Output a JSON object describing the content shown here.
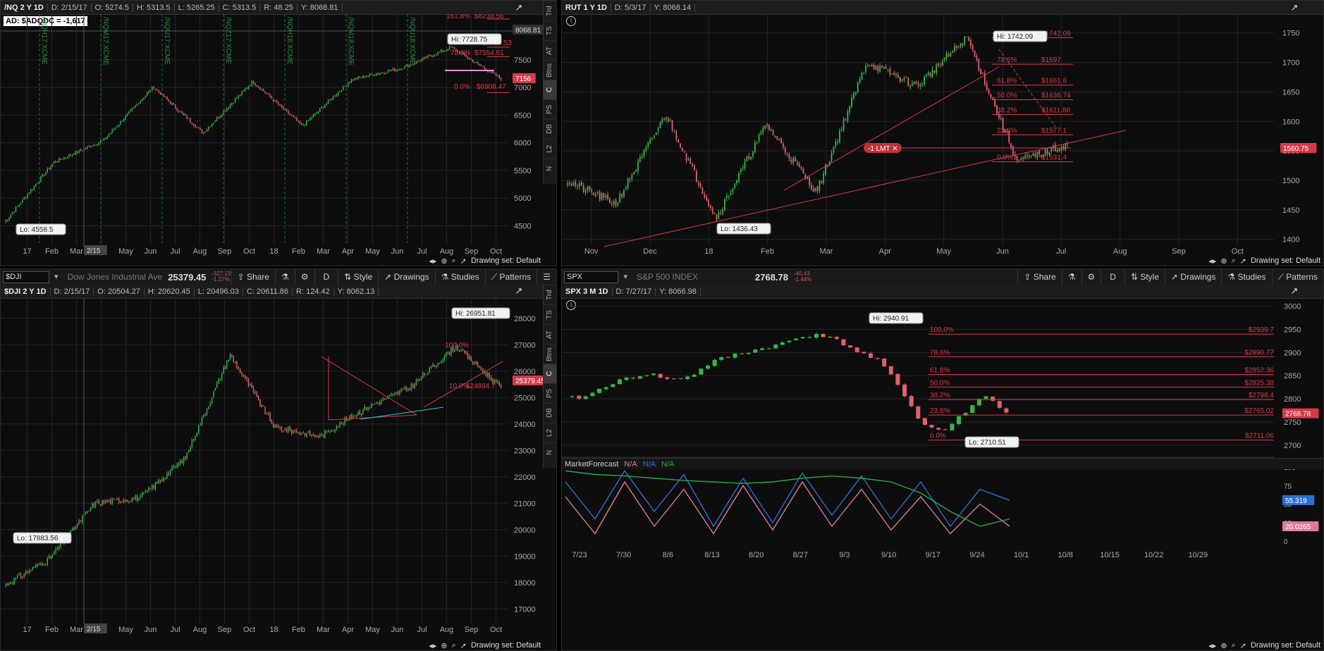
{
  "colors": {
    "up": "#2fb84a",
    "down": "#e0606b",
    "fib": "#d8384a",
    "grid": "#242424",
    "axis": "#aaaaaa",
    "bg": "#0d0d0d"
  },
  "drawing_set": "Drawing set: Default",
  "side_tabs": [
    "Trd",
    "TS",
    "AT",
    "Btns",
    "C",
    "PS",
    "DB",
    "L2",
    "N"
  ],
  "top_left": {
    "header": {
      "symbol": "/NQ 2 Y 1D",
      "d": "D: 2/15/17",
      "o": "O: 5274.5",
      "h": "H: 5313.5",
      "l": "L: 5265.25",
      "c": "C: 5313.5",
      "r": "R: 48.25",
      "y": "Y: 8068.81"
    },
    "ad_label": "AD: $ADQDC = -1,617",
    "price_tags": {
      "top": "8068.81",
      "last": "7156"
    },
    "hi_label": "Hi: 7728.75",
    "lo_label": "Lo: 4558.5",
    "cursor_date": "2/15",
    "contract_labels": [
      "/NQH17:XCME",
      "/NQM17:XCME",
      "/NQU17:XCME",
      "/NQZ17:XCME",
      "/NQH18:XCME",
      "/NQM18:XCME",
      "/NQU18:XCME"
    ],
    "fib_labels": [
      "161.8%",
      "$8238.56",
      "78.6%",
      "$7554.61",
      "0.0%",
      "$6908.47",
      "$7780.53"
    ],
    "chart_data": {
      "type": "line",
      "title": "/NQ 2 Y 1D",
      "x": [
        "2/15/17",
        "6/1/17",
        "10/1/17",
        "1/26/18",
        "2/9/18",
        "3/12/18",
        "4/2/18",
        "6/1/18",
        "8/1/18",
        "8/30/18",
        "10/11/18"
      ],
      "values": [
        4558.5,
        5650,
        6050,
        7010,
        6180,
        7110,
        6300,
        7150,
        7350,
        7728.75,
        7156
      ],
      "x_ticks": [
        "17",
        "Feb",
        "Mar",
        "Apr",
        "May",
        "Jun",
        "Jul",
        "Aug",
        "Sep",
        "Oct",
        "18",
        "Feb",
        "Mar",
        "Apr",
        "May",
        "Jun",
        "Jul",
        "Aug",
        "Sep",
        "Oct"
      ],
      "y_ticks": [
        4500,
        5000,
        5500,
        6000,
        6500,
        7000,
        7500
      ],
      "ylim": [
        4250,
        8200
      ],
      "fib_levels": [
        {
          "pct": "0.0%",
          "value": 6908.47
        },
        {
          "pct": "78.6%",
          "value": 7554.61
        },
        {
          "pct": "100%",
          "value": 7728.75
        },
        {
          "pct": "161.8%",
          "value": 8238.56
        }
      ]
    }
  },
  "top_right": {
    "header": {
      "symbol": "RUT 1 Y 1D",
      "d": "D: 5/3/17",
      "y": "Y: 8068.14"
    },
    "hi_label": "Hi: 1742.09",
    "lo_label": "Lo: 1436.43",
    "order_label": "-1 LMT",
    "price_tag": "1560.75",
    "fib_pcts": [
      "78.6%",
      "61.8%",
      "50.0%",
      "38.2%",
      "23.6%",
      "0.0%"
    ],
    "fib_prices": [
      "$1742.09",
      "$1697",
      "$1661.6",
      "$1636.74",
      "$1611.88",
      "$1577.1",
      "$1531.4"
    ],
    "chart_data": {
      "type": "line",
      "title": "RUT 1 Y 1D",
      "x": [
        "10/20/17",
        "11/15/17",
        "1/23/18",
        "2/8/18",
        "3/13/18",
        "4/2/18",
        "6/20/18",
        "7/20/18",
        "8/31/18",
        "10/11/18",
        "10/19/18"
      ],
      "values": [
        1500,
        1460,
        1612,
        1436.43,
        1595,
        1480,
        1700,
        1660,
        1742.09,
        1531.4,
        1560.75
      ],
      "x_ticks": [
        "Nov",
        "Dec",
        "18",
        "Feb",
        "Mar",
        "Apr",
        "May",
        "Jun",
        "Jul",
        "Aug",
        "Sep",
        "Oct"
      ],
      "y_ticks": [
        1400,
        1450,
        1500,
        1550,
        1600,
        1650,
        1700,
        1750
      ],
      "ylim": [
        1390,
        1770
      ],
      "fib_levels": [
        {
          "pct": "100%",
          "value": 1742.09
        },
        {
          "pct": "78.6%",
          "value": 1697
        },
        {
          "pct": "61.8%",
          "value": 1661.6
        },
        {
          "pct": "50.0%",
          "value": 1636.74
        },
        {
          "pct": "38.2%",
          "value": 1611.88
        },
        {
          "pct": "23.6%",
          "value": 1577.1
        },
        {
          "pct": "0.0%",
          "value": 1531.4
        }
      ]
    }
  },
  "bottom_left": {
    "toolbar": {
      "symbol": "$DJI",
      "description": "Dow Jones Industrial Average",
      "last": "25379.45",
      "change": "-327.23",
      "change_pct": "-1.27%",
      "share": "Share",
      "aggregation": "D",
      "style": "Style",
      "drawings": "Drawings",
      "studies": "Studies",
      "patterns": "Patterns"
    },
    "header": {
      "symbol": "$DJI 2 Y 1D",
      "d": "D: 2/15/17",
      "o": "O: 20504.27",
      "h": "H: 20620.45",
      "l": "L: 20496.03",
      "c": "C: 20611.86",
      "r": "R: 124.42",
      "y": "Y: 8062.13"
    },
    "hi_label": "Hi: 26951.81",
    "lo_label": "Lo: 17883.56",
    "price_tag": "25379.45",
    "cursor_date": "2/15",
    "fib_labels": [
      "100.0%",
      "$24894.7",
      "10.0%"
    ],
    "chart_data": {
      "type": "line",
      "title": "$DJI 2 Y 1D",
      "x": [
        "10/20/16",
        "11/15/16",
        "3/1/17",
        "6/1/17",
        "10/1/17",
        "1/26/18",
        "2/9/18",
        "3/23/18",
        "6/1/18",
        "8/1/18",
        "10/3/18",
        "10/19/18"
      ],
      "values": [
        17883.56,
        18900,
        21000,
        21200,
        22700,
        26616,
        23860,
        23533,
        24600,
        25400,
        26951.81,
        25379.45
      ],
      "x_ticks": [
        "17",
        "Feb",
        "Mar",
        "Apr",
        "May",
        "Jun",
        "Jul",
        "Aug",
        "Sep",
        "Oct",
        "18",
        "Feb",
        "Mar",
        "Apr",
        "May",
        "Jun",
        "Jul",
        "Aug",
        "Sep",
        "Oct"
      ],
      "y_ticks": [
        17000,
        18000,
        19000,
        20000,
        21000,
        22000,
        23000,
        24000,
        25000,
        26000,
        27000,
        28000
      ],
      "ylim": [
        16500,
        28500
      ]
    }
  },
  "bottom_right": {
    "toolbar": {
      "symbol": "SPX",
      "description": "S&P 500 INDEX",
      "last": "2768.78",
      "change": "-40.43",
      "change_pct": "-1.44%",
      "share": "Share",
      "aggregation": "D",
      "style": "Style",
      "drawings": "Drawings",
      "studies": "Studies",
      "patterns": "Patterns"
    },
    "header": {
      "symbol": "SPX 3 M 1D",
      "d": "D: 7/27/17",
      "y": "Y: 8066.98"
    },
    "hi_label": "Hi: 2940.91",
    "lo_label": "Lo: 2710.51",
    "price_tag": "2768.78",
    "indicator": {
      "name": "MarketForecast",
      "vals": [
        "N/A",
        "N/A",
        "N/A"
      ],
      "tag1": "55.319",
      "tag2": "20.0265"
    },
    "chart_data": {
      "type": "line",
      "title": "SPX 3 M 1D",
      "x_ticks": [
        "7/23",
        "7/30",
        "8/6",
        "8/13",
        "8/20",
        "8/27",
        "9/3",
        "9/10",
        "9/17",
        "9/24",
        "10/1",
        "10/8",
        "10/15",
        "10/22",
        "10/29"
      ],
      "values": [
        2800,
        2805,
        2830,
        2845,
        2855,
        2840,
        2850,
        2880,
        2895,
        2905,
        2915,
        2930,
        2940.91,
        2925,
        2900,
        2880,
        2820,
        2745,
        2730,
        2770,
        2810,
        2768.78
      ],
      "y_ticks": [
        2700,
        2750,
        2800,
        2850,
        2900,
        2950,
        3000
      ],
      "ylim": [
        2680,
        3010
      ],
      "fib_levels": [
        {
          "pct": "100.0%",
          "value": 2939.7
        },
        {
          "pct": "78.6%",
          "value": 2890.77
        },
        {
          "pct": "61.8%",
          "value": 2852.36
        },
        {
          "pct": "50.0%",
          "value": 2825.38
        },
        {
          "pct": "38.2%",
          "value": 2798.4
        },
        {
          "pct": "23.6%",
          "value": 2765.02
        },
        {
          "pct": "0.0%",
          "value": 2711.06
        }
      ],
      "indicator_series": [
        {
          "name": "MarketForecast 1",
          "color": "#2a6fd6",
          "values": [
            80,
            30,
            95,
            40,
            90,
            20,
            85,
            25,
            92,
            35,
            88,
            30,
            80,
            20,
            70,
            55.319
          ]
        },
        {
          "name": "MarketForecast 2",
          "color": "#e07a9a",
          "values": [
            60,
            10,
            80,
            20,
            70,
            10,
            75,
            15,
            80,
            20,
            70,
            15,
            60,
            10,
            50,
            20.0265
          ]
        },
        {
          "name": "MarketForecast 3",
          "color": "#28a845",
          "values": [
            95,
            90,
            88,
            85,
            82,
            80,
            78,
            80,
            85,
            88,
            85,
            80,
            65,
            40,
            20,
            30
          ]
        }
      ],
      "indicator_ticks": [
        0,
        25,
        50,
        75,
        100
      ]
    }
  }
}
